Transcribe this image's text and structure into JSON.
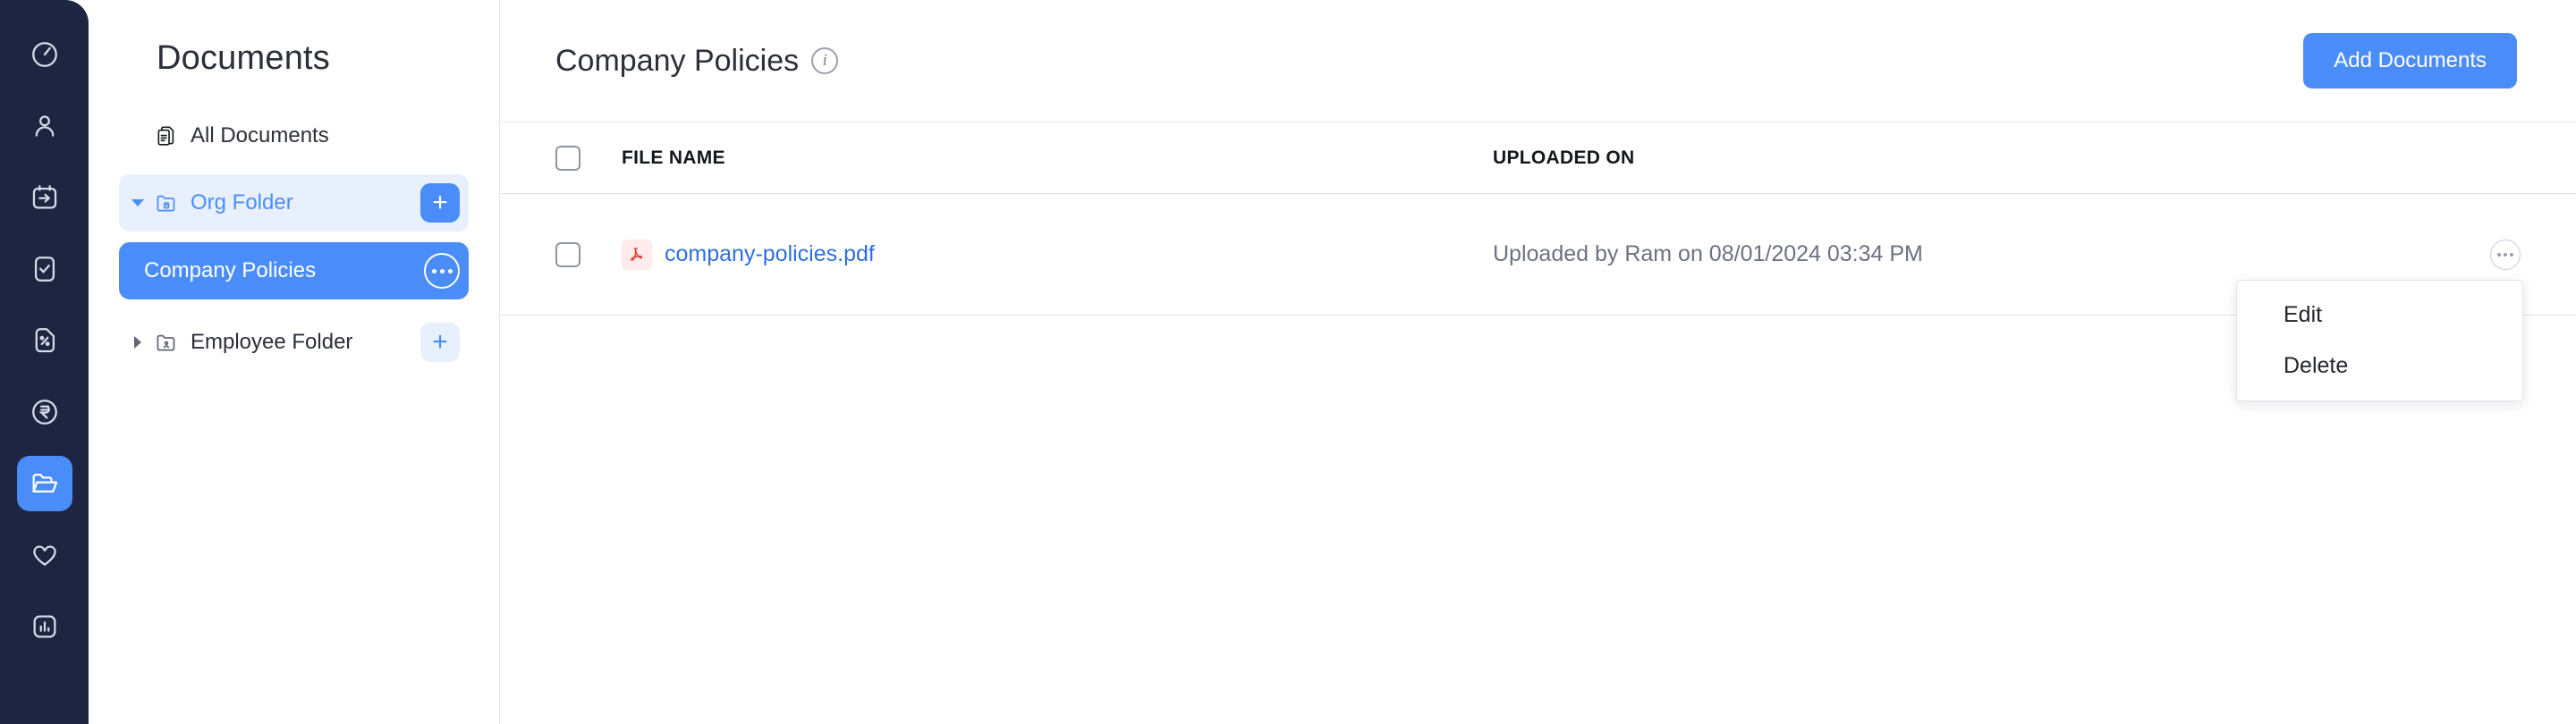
{
  "rail": {
    "items": [
      {
        "name": "dashboard-clock-icon",
        "label": "Dashboard",
        "active": false
      },
      {
        "name": "people-icon",
        "label": "People",
        "active": false
      },
      {
        "name": "calendar-arrow-icon",
        "label": "Leave",
        "active": false
      },
      {
        "name": "checklist-icon",
        "label": "Tasks",
        "active": false
      },
      {
        "name": "percent-document-icon",
        "label": "Payroll Tax",
        "active": false
      },
      {
        "name": "rupee-circle-icon",
        "label": "Payroll",
        "active": false
      },
      {
        "name": "folder-open-icon",
        "label": "Documents",
        "active": true
      },
      {
        "name": "heart-icon",
        "label": "Benefits",
        "active": false
      },
      {
        "name": "bar-chart-icon",
        "label": "Reports",
        "active": false
      }
    ]
  },
  "docpanel": {
    "title": "Documents",
    "all_documents_label": "All Documents",
    "tree": [
      {
        "label": "Org Folder",
        "caret": "down",
        "state": "soft-selected",
        "action": "plus",
        "action_label": "+",
        "icon": "folder-org-icon"
      },
      {
        "label": "Company Policies",
        "caret": "none",
        "state": "selected",
        "action": "dots",
        "icon": "none",
        "child": true
      },
      {
        "label": "Employee Folder",
        "caret": "right",
        "state": "normal",
        "action": "plus",
        "action_label": "+",
        "icon": "folder-employee-icon"
      }
    ]
  },
  "main": {
    "page_title": "Company Policies",
    "info_glyph": "i",
    "add_button": "Add Documents",
    "table": {
      "columns": [
        "FILE NAME",
        "UPLOADED ON"
      ],
      "rows": [
        {
          "file_name": "company-policies.pdf",
          "file_type": "pdf",
          "uploaded_on": "Uploaded by Ram on 08/01/2024 03:34 PM",
          "checked": false
        }
      ]
    },
    "menu": {
      "items": [
        "Edit",
        "Delete"
      ]
    }
  },
  "colors": {
    "accent": "#4b8df8",
    "accent_soft": "#e8f0fe",
    "rail_bg": "#1e2541",
    "link": "#2f6fdd",
    "pdf_red": "#e8413a",
    "text": "#2b2f38",
    "muted": "#6c7280",
    "border": "#e2e4e8"
  }
}
